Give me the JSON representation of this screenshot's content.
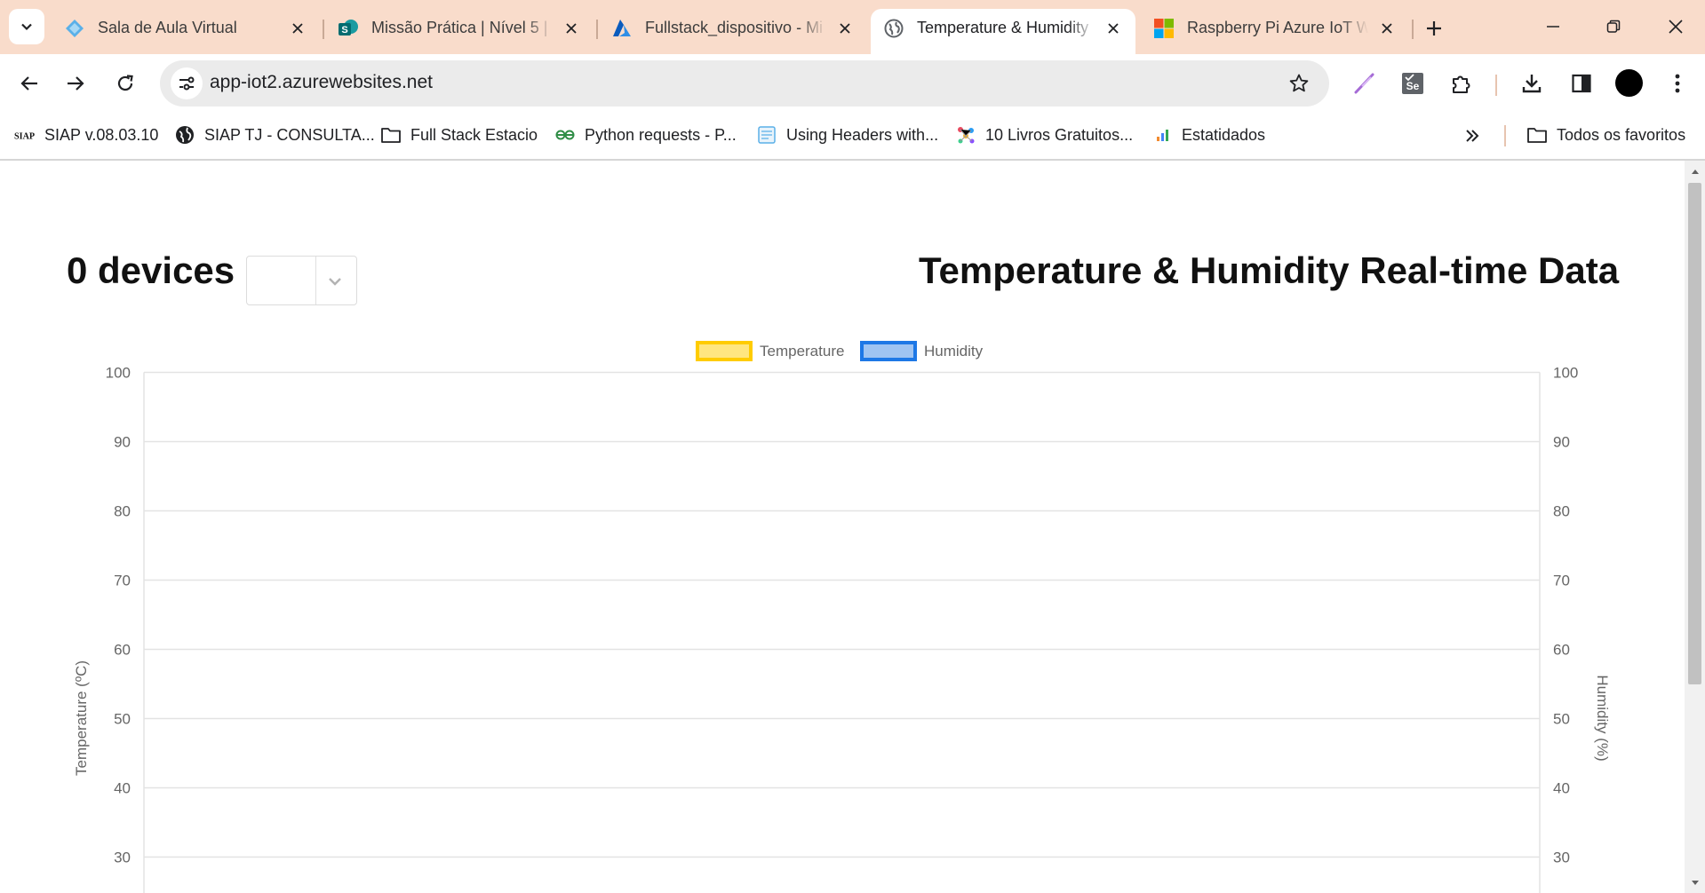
{
  "browser": {
    "tabs": [
      {
        "title": "Sala de Aula Virtual",
        "favicon": "diamond-icon"
      },
      {
        "title": "Missão Prática | Nível 5 |",
        "favicon": "sharepoint-icon"
      },
      {
        "title": "Fullstack_dispositivo - Mi",
        "favicon": "azure-icon"
      },
      {
        "title": "Temperature & Humidity",
        "favicon": "globe-icon",
        "active": true
      },
      {
        "title": "Raspberry Pi Azure IoT W",
        "favicon": "microsoft-icon"
      }
    ],
    "url": "app-iot2.azurewebsites.net",
    "bookmarks": [
      {
        "label": "SIAP v.08.03.10",
        "icon": "siap-logo-icon"
      },
      {
        "label": "SIAP TJ - CONSULTA...",
        "icon": "globe-icon"
      },
      {
        "label": "Full Stack Estacio",
        "icon": "folder-icon"
      },
      {
        "label": "Python requests - P...",
        "icon": "geeksforgeeks-icon"
      },
      {
        "label": "Using Headers with...",
        "icon": "calendar-page-icon"
      },
      {
        "label": "10 Livros Gratuitos...",
        "icon": "molecule-icon"
      },
      {
        "label": "Estatidados",
        "icon": "bar-chart-icon"
      }
    ],
    "all_bookmarks_label": "Todos os favoritos",
    "bookmark_logo_text": "SIAP"
  },
  "page": {
    "devices_heading": "0 devices",
    "device_select_value": "",
    "title": "Temperature & Humidity Real-time Data"
  },
  "colors": {
    "tabstrip_bg": "#f9dccb",
    "temperature_border": "#ffcc00",
    "temperature_fill": "#ffe680",
    "humidity_border": "#1e78e6",
    "humidity_fill": "#9fc4f2",
    "grid": "#e3e3e3",
    "tick": "#666666"
  },
  "chart_data": {
    "type": "line",
    "legend": [
      "Temperature",
      "Humidity"
    ],
    "legend_position": "top",
    "series": [
      {
        "name": "Temperature",
        "values": [],
        "axis": "left"
      },
      {
        "name": "Humidity",
        "values": [],
        "axis": "right"
      }
    ],
    "ylabel_left": "Temperature (ºC)",
    "ylabel_right": "Humidity (%)",
    "y_ticks_visible": [
      100,
      90,
      80,
      70,
      60,
      50,
      40,
      30
    ],
    "ylim": [
      0,
      100
    ],
    "grid": true
  }
}
